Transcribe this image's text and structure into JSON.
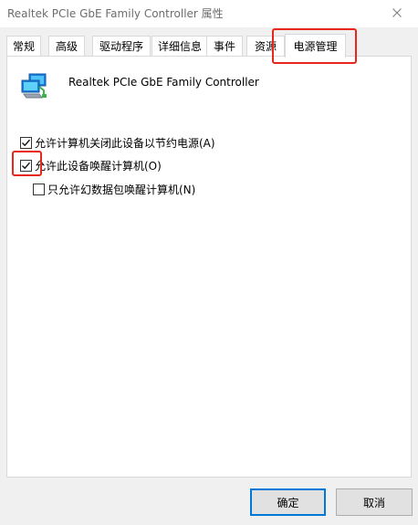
{
  "window": {
    "title": "Realtek PCIe GbE Family Controller 属性"
  },
  "tabs": [
    {
      "label": "常规"
    },
    {
      "label": "高级"
    },
    {
      "label": "驱动程序"
    },
    {
      "label": "详细信息"
    },
    {
      "label": "事件"
    },
    {
      "label": "资源"
    },
    {
      "label": "电源管理",
      "active": true
    }
  ],
  "power_panel": {
    "device_icon": "network-adapter-icon",
    "device_name": "Realtek PCIe GbE Family Controller",
    "options": [
      {
        "label": "允许计算机关闭此设备以节约电源(A)",
        "checked": true
      },
      {
        "label": "允许此设备唤醒计算机(O)",
        "checked": true
      },
      {
        "label": "只允许幻数据包唤醒计算机(N)",
        "checked": false
      }
    ]
  },
  "buttons": {
    "ok": "确定",
    "cancel": "取消"
  },
  "colors": {
    "highlight": "#e8261c",
    "default_button_border": "#0078d7"
  }
}
